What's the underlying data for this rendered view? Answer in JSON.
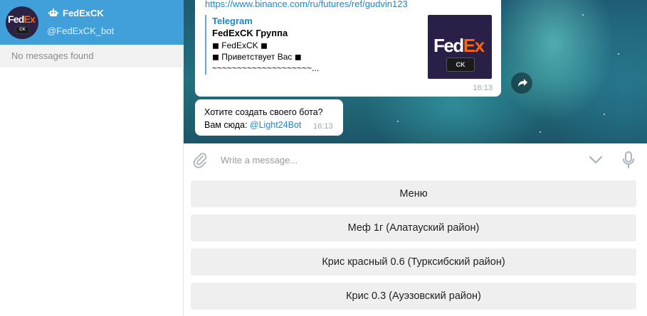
{
  "sidebar": {
    "chat": {
      "title": "FedExCK",
      "username": "@FedExCK_bot",
      "avatar_logo_fed": "Fed",
      "avatar_logo_ex": "Ex",
      "avatar_badge": "CK",
      "icon": "bot-icon"
    },
    "empty_text": "No messages found"
  },
  "messages": [
    {
      "link_text": "https://www.binance.com/ru/futures/ref/gudvin123",
      "preview": {
        "site": "Telegram",
        "title": "FedExCK Группа",
        "line1": "◼ FedExCK ◼",
        "line2": "◼ Приветствует Вас ◼",
        "line3": "~~~~~~~~~~~~~~~~~~~~...",
        "thumb_logo_fed": "Fed",
        "thumb_logo_ex": "Ex",
        "thumb_badge": "CK"
      },
      "time": "16:13"
    },
    {
      "line1": "Хотите создать своего бота?",
      "line2_prefix": "Вам сюда: ",
      "line2_link": "@Light24Bot",
      "time": "16:13"
    }
  ],
  "composer": {
    "placeholder": "Write a message...",
    "value": ""
  },
  "keyboard": {
    "buttons": [
      "Меню",
      "Меф 1г (Алатауский район)",
      "Крис красный 0.6 (Турксибский район)",
      "Крис 0.3 (Ауэзовский район)"
    ]
  },
  "colors": {
    "selected_chat_bg": "#419fd9",
    "link": "#168acd",
    "fedex_purple": "#4d148c",
    "fedex_orange": "#ff6600"
  }
}
